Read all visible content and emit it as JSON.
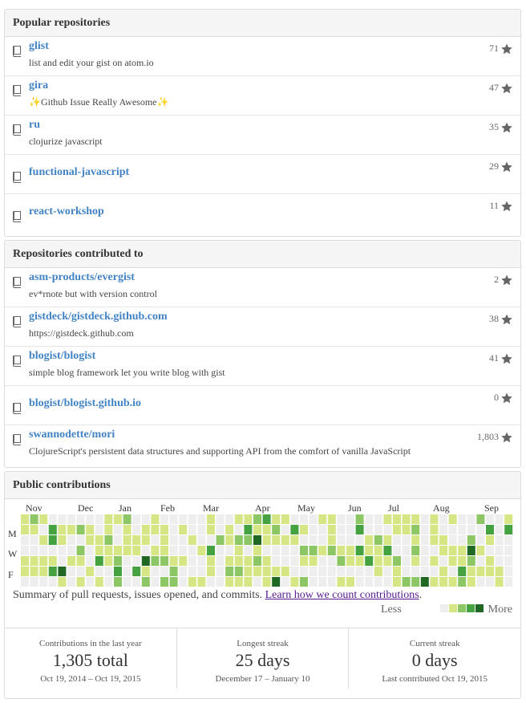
{
  "popular": {
    "header": "Popular repositories",
    "repos": [
      {
        "name": "glist",
        "desc": "list and edit your gist on atom.io",
        "stars": "71"
      },
      {
        "name": "gira",
        "desc": "✨Github Issue Really Awesome✨",
        "stars": "47"
      },
      {
        "name": "ru",
        "desc": "clojurize javascript",
        "stars": "35"
      },
      {
        "name": "functional-javascript",
        "desc": "",
        "stars": "29"
      },
      {
        "name": "react-workshop",
        "desc": "",
        "stars": "11"
      }
    ]
  },
  "contributed": {
    "header": "Repositories contributed to",
    "repos": [
      {
        "name": "asm-products/evergist",
        "desc": "ev*rnote but with version control",
        "stars": "2"
      },
      {
        "name": "gistdeck/gistdeck.github.com",
        "desc": "https://gistdeck.github.com",
        "stars": "38"
      },
      {
        "name": "blogist/blogist",
        "desc": "simple blog framework let you write blog with gist",
        "stars": "41"
      },
      {
        "name": "blogist/blogist.github.io",
        "desc": "",
        "stars": "0"
      },
      {
        "name": "swannodette/mori",
        "desc": "ClojureScript's persistent data structures and supporting API from the comfort of vanilla JavaScript",
        "stars": "1,803"
      }
    ]
  },
  "contributions": {
    "header": "Public contributions",
    "months": [
      "Nov",
      "Dec",
      "Jan",
      "Feb",
      "Mar",
      "Apr",
      "May",
      "Jun",
      "Jul",
      "Aug",
      "Sep"
    ],
    "day_labels": [
      "M",
      "W",
      "F"
    ],
    "summary": "Summary of pull requests, issues opened, and commits.",
    "link": "Learn how we count contributions",
    "period": ".",
    "legend_less": "Less",
    "legend_more": "More",
    "colors": [
      "#eeeeee",
      "#d6e685",
      "#8cc665",
      "#44a340",
      "#1e6823"
    ],
    "stats": [
      {
        "caption": "Contributions in the last year",
        "value": "1,305 total",
        "range": "Oct 19, 2014 – Oct 19, 2015"
      },
      {
        "caption": "Longest streak",
        "value": "25 days",
        "range": "December 17 – January 10"
      },
      {
        "caption": "Current streak",
        "value": "0 days",
        "range": "Last contributed Oct 19, 2015"
      }
    ]
  }
}
